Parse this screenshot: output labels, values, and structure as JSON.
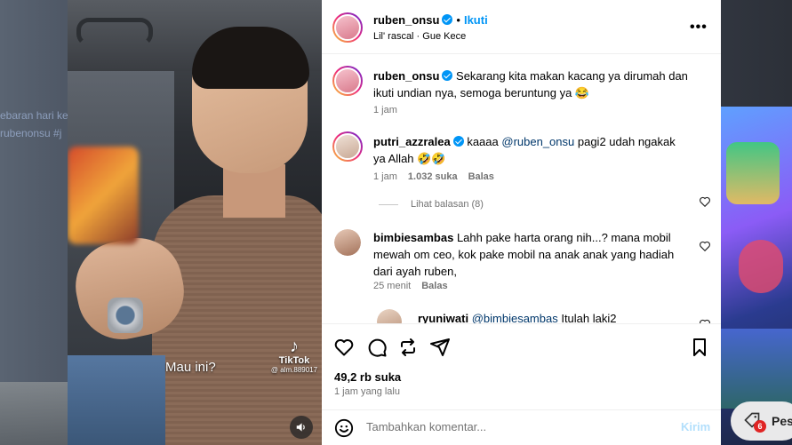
{
  "background": {
    "left_text": [
      "ebaran hari ke",
      "rubenonsu #j"
    ],
    "promo_badge": "6",
    "promo_text": "Pes"
  },
  "video": {
    "caption": "Mau ini?",
    "tiktok_brand": "TikTok",
    "tiktok_handle": "@ alm.889017"
  },
  "post": {
    "author": "ruben_onsu",
    "follow_label": "Ikuti",
    "dot": "•",
    "audio": "Lil' rascal · Gue Kece",
    "more_label": "•••"
  },
  "comments": [
    {
      "user": "ruben_onsu",
      "text": "Sekarang kita makan kacang ya dirumah dan ikuti undian nya, semoga beruntung ya 😂",
      "time": "1 jam"
    },
    {
      "user": "putri_azzralea",
      "mention": "@ruben_onsu",
      "text_before": "kaaaa ",
      "text_after": " pagi2 udah ngakak ya Allah 🤣🤣",
      "time": "1 jam",
      "likes": "1.032 suka",
      "reply": "Balas",
      "view_replies": "Lihat balasan (8)"
    },
    {
      "user": "bimbiesambas",
      "text": "Lahh pake harta orang nih...? mana mobil mewah om ceo, kok pake mobil na anak anak yang hadiah dari ayah ruben,",
      "time": "25 menit",
      "reply": "Balas"
    },
    {
      "user": "ryuniwati",
      "mention": "@bimbiesambas",
      "text_after": " Itulah laki2"
    }
  ],
  "footer": {
    "likes": "49,2 rb suka",
    "time": "1 jam yang lalu",
    "placeholder": "Tambahkan komentar...",
    "send": "Kirim"
  },
  "colors": {
    "link": "#0095f6",
    "mention": "#00376b",
    "muted": "#737373"
  }
}
